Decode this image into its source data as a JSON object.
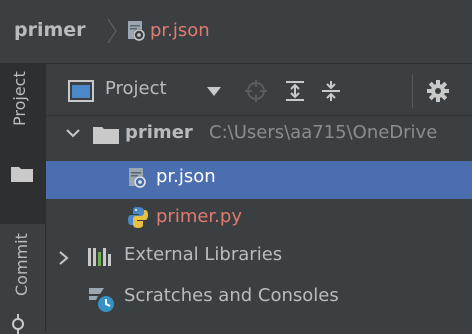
{
  "breadcrumb": {
    "project": "primer",
    "file": "pr.json"
  },
  "tool_strip": {
    "project_tab": "Project",
    "commit_tab": "Commit"
  },
  "toolbar": {
    "view_label": "Project",
    "icons": [
      "window-icon",
      "dropdown-arrow-icon",
      "locate-icon",
      "expand-all-icon",
      "collapse-all-icon",
      "gear-icon"
    ]
  },
  "tree": {
    "root": {
      "name": "primer",
      "path": "C:\\Users\\aa715\\OneDrive"
    },
    "items": [
      {
        "name": "pr.json",
        "selected": true
      },
      {
        "name": "primer.py",
        "selected": false
      }
    ],
    "external_libraries": "External Libraries",
    "scratches": "Scratches and Consoles"
  },
  "colors": {
    "background": "#3c3f41",
    "selection": "#4b6eaf",
    "text": "#bbbbbb",
    "error_text": "#e07b70",
    "path_text": "#8c8c8c"
  }
}
